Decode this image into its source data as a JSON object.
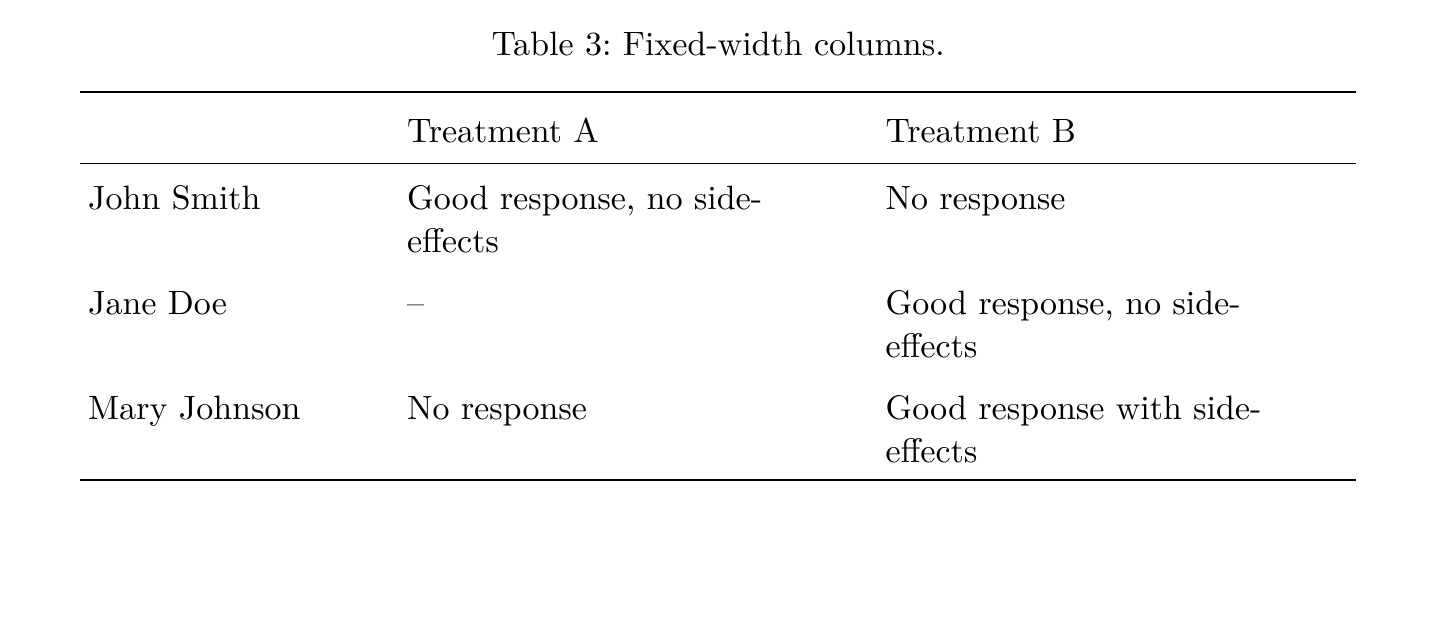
{
  "caption": "Table 3: Fixed-width columns.",
  "headers": {
    "col1": "",
    "col2": "Treatment A",
    "col3": "Treatment B"
  },
  "rows": [
    {
      "name": "John Smith",
      "treatment_a": "Good response, no side-effects",
      "treatment_b": "No response"
    },
    {
      "name": "Jane Doe",
      "treatment_a": "–",
      "treatment_b": "Good response, no side-effects"
    },
    {
      "name": "Mary Johnson",
      "treatment_a": "No response",
      "treatment_b": "Good response with side-effects"
    }
  ]
}
